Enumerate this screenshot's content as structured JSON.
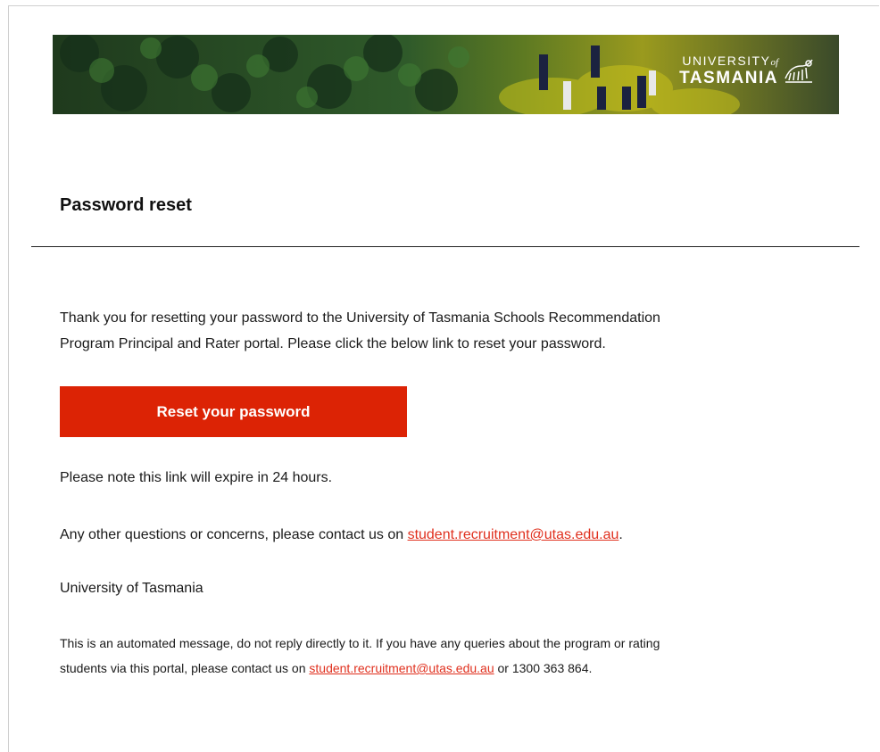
{
  "banner": {
    "logo_line1": "UNIVERSITY",
    "logo_of": "of",
    "logo_line2": "TASMANIA",
    "logo_icon": "tasmanian-tiger-crest-icon"
  },
  "email": {
    "title": "Password reset",
    "intro_line1": "Thank you for resetting your password to the University of Tasmania Schools Recommendation",
    "intro_line2": "Program Principal and Rater portal. Please click the below link to reset your password.",
    "button_label": "Reset your password",
    "expiry_note": "Please note this link will expire in 24 hours.",
    "contact_prefix": "Any other questions or concerns, please contact us on ",
    "contact_email": "student.recruitment@utas.edu.au",
    "contact_suffix": ".",
    "signoff": "University of Tasmania",
    "footer_line1": "This is an automated message, do not reply directly to it. If you have any queries about the program or rating",
    "footer_prefix": "students via this portal, please contact us on ",
    "footer_email": "student.recruitment@utas.edu.au",
    "footer_suffix": " or 1300 363 864."
  },
  "colors": {
    "accent": "#dc2305",
    "link": "#e0301e"
  }
}
